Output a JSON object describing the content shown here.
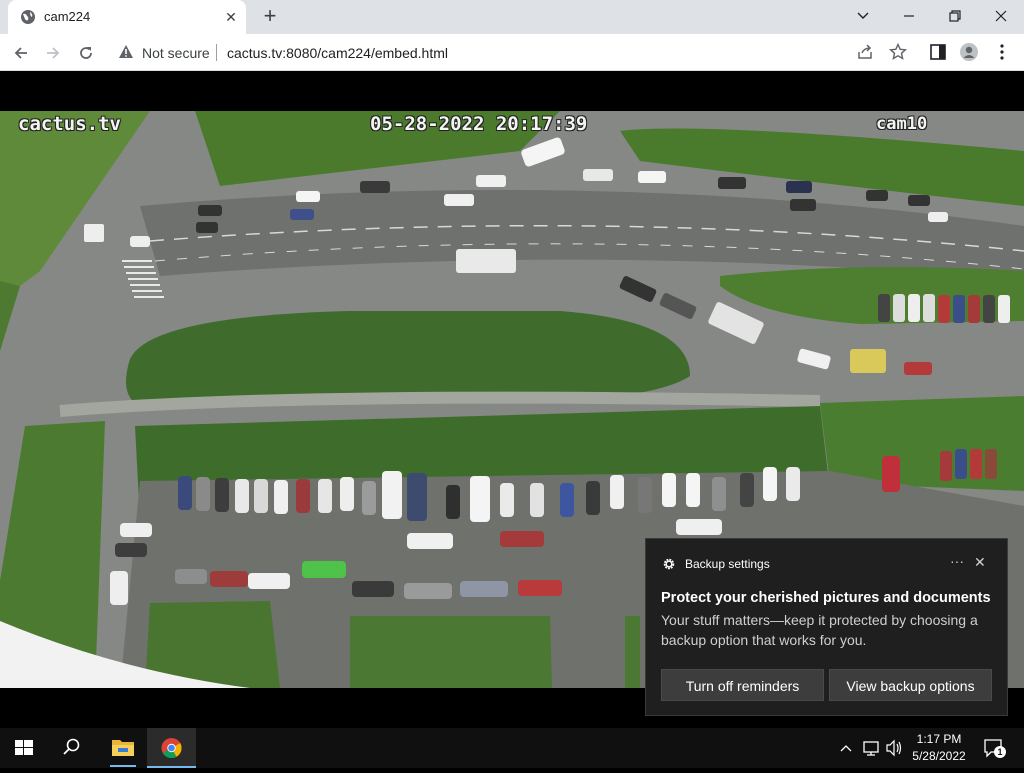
{
  "browser": {
    "tab_title": "cam224",
    "security_label": "Not secure",
    "url": "cactus.tv:8080/cam224/embed.html"
  },
  "camera": {
    "brand_overlay": "cactus.tv",
    "timestamp_overlay": "05-28-2022 20:17:39",
    "camera_id_overlay": "cam10"
  },
  "toast": {
    "app_name": "Backup settings",
    "more_label": "···",
    "close_label": "✕",
    "title": "Protect your cherished pictures and documents",
    "body": "Your stuff matters—keep it protected by choosing a backup option that works for you.",
    "button_left": "Turn off reminders",
    "button_right": "View backup options"
  },
  "taskbar": {
    "time": "1:17 PM",
    "date": "5/28/2022",
    "notification_count": "1"
  },
  "colors": {
    "chrome_tabstrip": "#dee1e6",
    "toast_bg": "#1f1f1f",
    "taskbar_bg": "#101010",
    "grass": "#3f6b2c",
    "asphalt": "#7b7d7a"
  }
}
